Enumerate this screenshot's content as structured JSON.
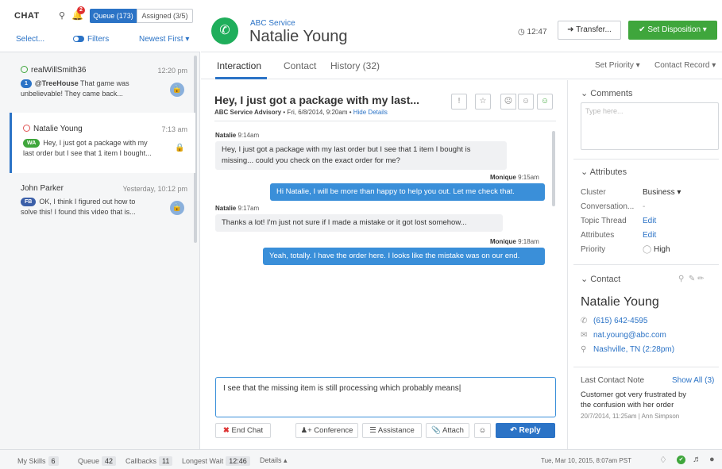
{
  "left": {
    "title": "CHAT",
    "bell_badge": "2",
    "queue_tab": "Queue (173)",
    "assigned_tab": "Assigned (3/5)",
    "select": "Select...",
    "filters": "Filters",
    "sort": "Newest First ▾",
    "conversations": [
      {
        "name": "realWillSmith36",
        "time": "12:20 pm",
        "pill": "1",
        "handle": "@TreeHouse",
        "msg1": " That game was",
        "msg2": "unbelievable! They came back..."
      },
      {
        "name": "Natalie Young",
        "time": "7:13 am",
        "pill": "WA",
        "msg1": "Hey, I just got a package with my",
        "msg2": "last order but I see that 1 item I bought..."
      },
      {
        "name": "John Parker",
        "time": "Yesterday, 10:12 pm",
        "pill": "FB",
        "msg1": "OK, I think I figured out how to",
        "msg2": "solve this! I found this video that is..."
      }
    ]
  },
  "header": {
    "service": "ABC Service",
    "customer": "Natalie Young",
    "timer": "12:47",
    "transfer": "Transfer...",
    "disposition": "Set Disposition ▾"
  },
  "tabs": {
    "interaction": "Interaction",
    "contact": "Contact",
    "history": "History (32)",
    "set_priority": "Set Priority ▾",
    "contact_record": "Contact Record ▾"
  },
  "thread": {
    "subject": "Hey, I just got a package with my last...",
    "advisory": "ABC Service Advisory",
    "date": " • Fri, 6/8/2014, 9:20am • ",
    "hide_details": "Hide Details",
    "messages": [
      {
        "sender": "Natalie",
        "time": "9:14am",
        "line1": "Hey, I just got a package with my last order but I see that 1 item I bought is",
        "line2": "missing... could you check on the exact order for me?"
      },
      {
        "sender": "Monique",
        "time": "9:15am",
        "line1": "Hi Natalie, I will be more than happy to help you out. Let me check that."
      },
      {
        "sender": "Natalie",
        "time": "9:17am",
        "line1": "Thanks a lot! I'm just not sure if I made a mistake or it got lost somehow..."
      },
      {
        "sender": "Monique",
        "time": "9:18am",
        "line1": "Yeah, totally. I have the order here. I looks like the mistake was on our end."
      }
    ]
  },
  "compose": {
    "text": "I see that the missing item is still processing which probably means|",
    "end_chat": "End Chat",
    "conference": "Conference",
    "assistance": "Assistance",
    "attach": "Attach",
    "reply": "Reply"
  },
  "right": {
    "comments_header": "Comments",
    "comments_placeholder": "Type here...",
    "attributes_header": "Attributes",
    "attributes": [
      {
        "key": "Cluster",
        "value": "Business ▾"
      },
      {
        "key": "Conversation...",
        "value": "-"
      },
      {
        "key": "Topic Thread",
        "value": "Edit"
      },
      {
        "key": "Attributes",
        "value": "Edit"
      },
      {
        "key": "Priority",
        "value": "High"
      }
    ],
    "contact_header": "Contact",
    "contact_name": "Natalie Young",
    "phone": "(615) 642-4595",
    "email": "nat.young@abc.com",
    "location": "Nashville, TN (2:28pm)",
    "last_note_label": "Last Contact Note",
    "show_all": "Show All (3)",
    "note_line1": "Customer got very frustrated by",
    "note_line2": "the confusion with her order",
    "note_date": "20/7/2014, 11:25am | Ann Simpson"
  },
  "footer": {
    "skills_label": "My Skills",
    "skills": "6",
    "queue_label": "Queue",
    "queue": "42",
    "callbacks_label": "Callbacks",
    "callbacks": "11",
    "wait_label": "Longest Wait",
    "wait": "12:46",
    "details": "Details ▴",
    "datetime": "Tue, Mar 10, 2015, 8:07am PST"
  }
}
